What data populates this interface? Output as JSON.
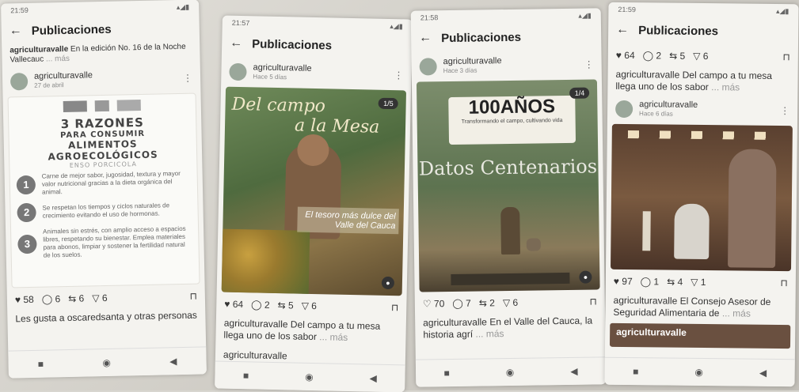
{
  "phones": [
    {
      "status_time": "21:59",
      "status_icons": "▴◢▮",
      "header": {
        "title": "Publicaciones"
      },
      "prev_caption": {
        "account": "agriculturavalle",
        "text": "En la edición No. 16 de la Noche Vallecauc",
        "more": "... más"
      },
      "post": {
        "account": "agriculturavalle",
        "date": "27 de abril"
      },
      "poster": {
        "title_num": "3 RAZONES",
        "title_line2": "PARA CONSUMIR",
        "title_line3": "ALIMENTOS",
        "title_line4": "AGROECOLÓGICOS",
        "subtitle": "ENSO PORCICOLA",
        "reasons": [
          {
            "n": "1",
            "text": "Carne de mejor sabor, jugosidad, textura y mayor valor nutricional gracias a la dieta orgánica del animal."
          },
          {
            "n": "2",
            "text": "Se respetan los tiempos y ciclos naturales de crecimiento evitando el uso de hormonas."
          },
          {
            "n": "3",
            "text": "Animales sin estrés, con amplio acceso a espacios libres, respetando su bienestar. Emplea materiales para abonos, limpiar y sostener la fertilidad natural de los suelos."
          }
        ]
      },
      "actions": {
        "likes": "58",
        "comments": "6",
        "shares": "6",
        "sends": "6"
      },
      "likes_text": "Les gusta a oscaredsanta y otras personas"
    },
    {
      "status_time": "21:57",
      "status_icons": "▴◢▮",
      "header": {
        "title": "Publicaciones"
      },
      "post": {
        "account": "agriculturavalle",
        "date": "Hace 5 días"
      },
      "image": {
        "overlay_top": "Del campo",
        "overlay_top2": "a la Mesa",
        "overlay_bottom": "El tesoro más dulce del Valle del Cauca",
        "badge": "1/5"
      },
      "actions": {
        "likes": "64",
        "comments": "2",
        "shares": "5",
        "sends": "6"
      },
      "caption": {
        "account": "agriculturavalle",
        "text": "Del campo a tu mesa llega uno de los sabor",
        "more": "... más"
      },
      "next_account": "agriculturavalle"
    },
    {
      "status_time": "21:58",
      "status_icons": "▴◢▮",
      "header": {
        "title": "Publicaciones"
      },
      "post": {
        "account": "agriculturavalle",
        "date": "Hace 3 días"
      },
      "image": {
        "logo": "100AÑOS",
        "logo_sub": "Transformando el campo, cultivando vida",
        "headline": "Datos Centenarios",
        "badge": "1/4"
      },
      "actions": {
        "likes": "70",
        "comments": "7",
        "shares": "2",
        "sends": "6"
      },
      "caption": {
        "account": "agriculturavalle",
        "text": "En el Valle del Cauca, la historia agrí",
        "more": "... más"
      }
    },
    {
      "status_time": "21:59",
      "status_icons": "▴◢▮",
      "header": {
        "title": "Publicaciones"
      },
      "actions_top": {
        "likes": "64",
        "comments": "2",
        "shares": "5",
        "sends": "6"
      },
      "caption_top": {
        "account": "agriculturavalle",
        "text": "Del campo a tu mesa llega uno de los sabor",
        "more": "... más"
      },
      "post": {
        "account": "agriculturavalle",
        "date": "Hace 6 días"
      },
      "actions": {
        "likes": "97",
        "comments": "1",
        "shares": "4",
        "sends": "1"
      },
      "caption": {
        "account": "agriculturavalle",
        "text": "El Consejo Asesor de Seguridad Alimentaria de",
        "more": "... más"
      },
      "next_account": "agriculturavalle"
    }
  ],
  "icons": {
    "back": "arrow-left-icon",
    "like": "heart-icon",
    "comment": "comment-icon",
    "share": "repost-icon",
    "send": "send-icon",
    "save": "bookmark-icon",
    "nav": [
      "square-icon",
      "circle-icon",
      "triangle-back-icon"
    ]
  },
  "colors": {
    "screen": "#f4f3ef",
    "text": "#222222",
    "muted": "#999999"
  }
}
